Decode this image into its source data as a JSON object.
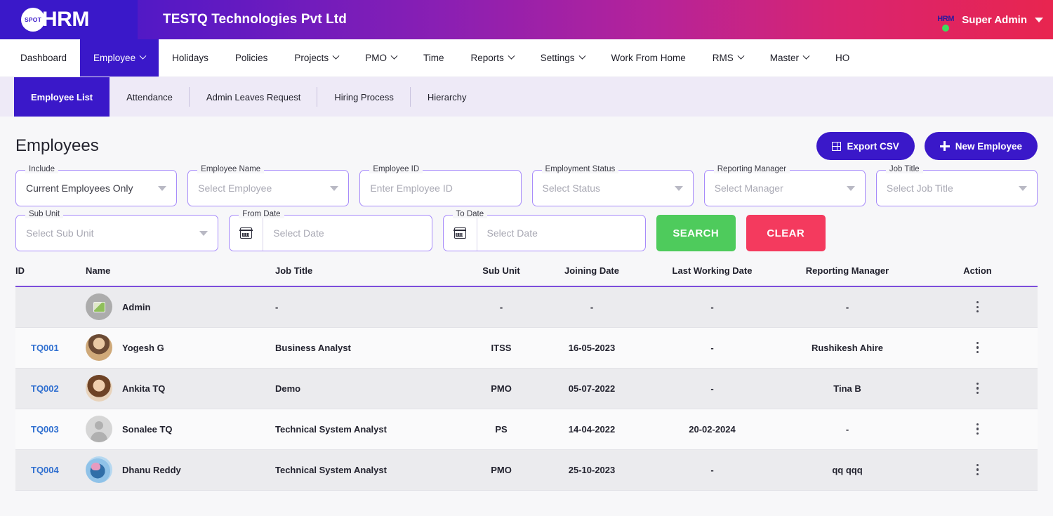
{
  "topbar": {
    "logo_badge": "SPOT",
    "logo_text": "HRM",
    "company": "TESTQ Technologies Pvt Ltd",
    "avatar_text": "HRM",
    "user": "Super Admin",
    "caret_icon": "chevron-down-icon",
    "status_icon": "online-status-dot"
  },
  "mainnav": [
    {
      "label": "Dashboard",
      "caret": false,
      "active": false
    },
    {
      "label": "Employee",
      "caret": true,
      "active": true
    },
    {
      "label": "Holidays",
      "caret": false,
      "active": false
    },
    {
      "label": "Policies",
      "caret": false,
      "active": false
    },
    {
      "label": "Projects",
      "caret": true,
      "active": false
    },
    {
      "label": "PMO",
      "caret": true,
      "active": false
    },
    {
      "label": "Time",
      "caret": false,
      "active": false
    },
    {
      "label": "Reports",
      "caret": true,
      "active": false
    },
    {
      "label": "Settings",
      "caret": true,
      "active": false
    },
    {
      "label": "Work From Home",
      "caret": false,
      "active": false
    },
    {
      "label": "RMS",
      "caret": true,
      "active": false
    },
    {
      "label": "Master",
      "caret": true,
      "active": false
    },
    {
      "label": "HO",
      "caret": false,
      "active": false
    }
  ],
  "subnav": [
    {
      "label": "Employee List",
      "active": true
    },
    {
      "label": "Attendance",
      "active": false
    },
    {
      "label": "Admin Leaves Request",
      "active": false
    },
    {
      "label": "Hiring Process",
      "active": false
    },
    {
      "label": "Hierarchy",
      "active": false
    }
  ],
  "page": {
    "title": "Employees",
    "export_label": "Export CSV",
    "new_label": "New Employee",
    "export_icon": "table-grid-icon",
    "new_icon": "plus-icon"
  },
  "filters": {
    "row1": [
      {
        "label": "Include",
        "value": "Current Employees Only",
        "placeholder": false,
        "type": "select"
      },
      {
        "label": "Employee Name",
        "value": "Select Employee",
        "placeholder": true,
        "type": "select"
      },
      {
        "label": "Employee ID",
        "value": "Enter Employee ID",
        "placeholder": true,
        "type": "text"
      },
      {
        "label": "Employment Status",
        "value": "Select Status",
        "placeholder": true,
        "type": "select"
      },
      {
        "label": "Reporting Manager",
        "value": "Select Manager",
        "placeholder": true,
        "type": "select"
      },
      {
        "label": "Job Title",
        "value": "Select Job Title",
        "placeholder": true,
        "type": "select"
      }
    ],
    "row2": [
      {
        "label": "Sub Unit",
        "value": "Select Sub Unit",
        "placeholder": true,
        "type": "select"
      },
      {
        "label": "From Date",
        "value": "Select Date",
        "placeholder": true,
        "type": "date"
      },
      {
        "label": "To Date",
        "value": "Select Date",
        "placeholder": true,
        "type": "date"
      }
    ],
    "search_label": "SEARCH",
    "clear_label": "CLEAR",
    "search_color": "#4ecb5c",
    "clear_color": "#f43a5e"
  },
  "table": {
    "columns": [
      "ID",
      "Name",
      "Job Title",
      "Sub Unit",
      "Joining Date",
      "Last Working Date",
      "Reporting Manager",
      "Action"
    ],
    "rows": [
      {
        "id": "",
        "name": "Admin",
        "avatar": "broken-image-avatar",
        "job_title": "-",
        "sub_unit": "-",
        "joining_date": "-",
        "last_working_date": "-",
        "reporting_manager": "-",
        "action": "more-options-icon"
      },
      {
        "id": "TQ001",
        "name": "Yogesh G",
        "avatar": "photo-avatar",
        "job_title": "Business Analyst",
        "sub_unit": "ITSS",
        "joining_date": "16-05-2023",
        "last_working_date": "-",
        "reporting_manager": "Rushikesh Ahire",
        "action": "more-options-icon"
      },
      {
        "id": "TQ002",
        "name": "Ankita TQ",
        "avatar": "photo-avatar",
        "job_title": "Demo",
        "sub_unit": "PMO",
        "joining_date": "05-07-2022",
        "last_working_date": "-",
        "reporting_manager": "Tina B",
        "action": "more-options-icon"
      },
      {
        "id": "TQ003",
        "name": "Sonalee TQ",
        "avatar": "generic-person-avatar",
        "job_title": "Technical System Analyst",
        "sub_unit": "PS",
        "joining_date": "14-04-2022",
        "last_working_date": "20-02-2024",
        "reporting_manager": "-",
        "action": "more-options-icon"
      },
      {
        "id": "TQ004",
        "name": "Dhanu Reddy",
        "avatar": "photo-avatar",
        "job_title": "Technical System Analyst",
        "sub_unit": "PMO",
        "joining_date": "25-10-2023",
        "last_working_date": "-",
        "reporting_manager": "qq qqq",
        "action": "more-options-icon"
      }
    ]
  },
  "colors": {
    "brand_indigo": "#3a18c9",
    "brand_rose": "#e8254f",
    "field_border": "#a78bfa",
    "table_rule": "#7c4ddb",
    "id_link": "#2f6fd0"
  }
}
